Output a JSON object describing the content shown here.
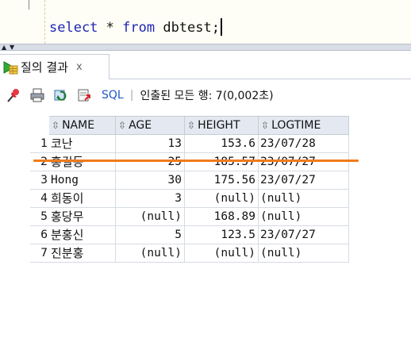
{
  "editor": {
    "tokens": [
      {
        "text": "select",
        "kw": true
      },
      {
        "text": " * ",
        "kw": false
      },
      {
        "text": "from",
        "kw": true
      },
      {
        "text": " dbtest;",
        "kw": false
      }
    ]
  },
  "tab": {
    "label": "질의 결과",
    "close": "x"
  },
  "toolbar": {
    "icons": [
      "pin-icon",
      "print-icon",
      "refresh-icon",
      "export-icon"
    ],
    "sql_label": "SQL",
    "separator": "|",
    "status": "인출된 모든 행: 7(0,002초)"
  },
  "grid": {
    "sort_glyph": "⇳",
    "columns": [
      "NAME",
      "AGE",
      "HEIGHT",
      "LOGTIME"
    ],
    "rows": [
      {
        "rownum": "1",
        "name": "코난",
        "age": "13",
        "height": "153.6",
        "logtime": "23/07/28"
      },
      {
        "rownum": "2",
        "name": "홍길동",
        "age": "25",
        "height": "185.57",
        "logtime": "23/07/27"
      },
      {
        "rownum": "3",
        "name": "Hong",
        "age": "30",
        "height": "175.56",
        "logtime": "23/07/27"
      },
      {
        "rownum": "4",
        "name": "희동이",
        "age": "3",
        "height": "(null)",
        "logtime": "(null)"
      },
      {
        "rownum": "5",
        "name": "홍당무",
        "age": "(null)",
        "height": "168.89",
        "logtime": "(null)"
      },
      {
        "rownum": "6",
        "name": "분홍신",
        "age": "5",
        "height": "123.5",
        "logtime": "23/07/27"
      },
      {
        "rownum": "7",
        "name": "진분홍",
        "age": "(null)",
        "height": "(null)",
        "logtime": "(null)"
      }
    ]
  },
  "colors": {
    "keyword": "#1d25b8",
    "sql_link": "#1c57c7",
    "highlight_underline": "#f07b1b"
  }
}
